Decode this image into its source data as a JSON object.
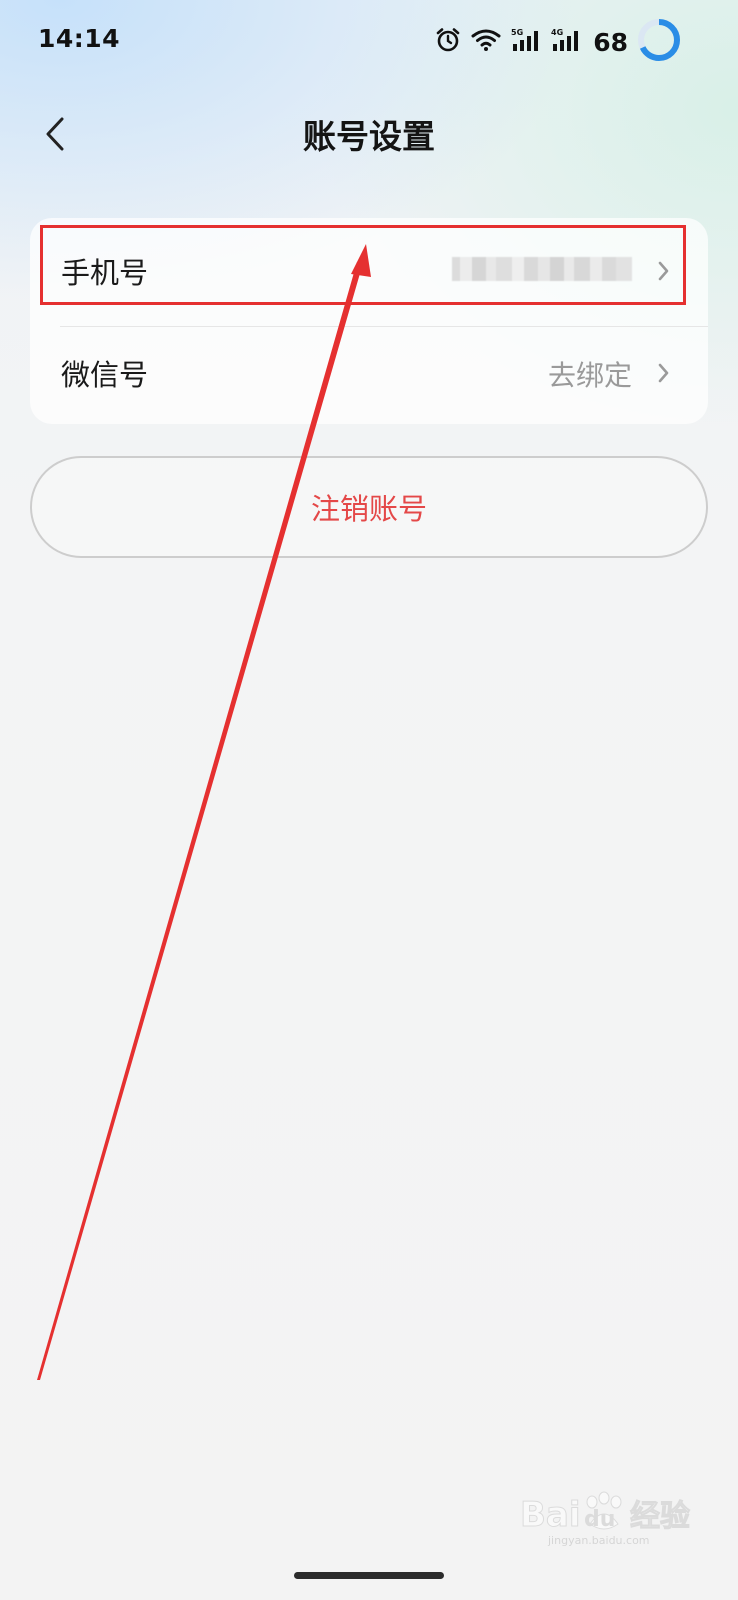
{
  "status_bar": {
    "time": "14:14",
    "battery_level": "68",
    "icons": [
      "alarm-icon",
      "wifi-icon",
      "signal-5g-icon",
      "signal-4g-icon"
    ],
    "network_5g": "5G",
    "network_4g": "4G"
  },
  "nav": {
    "title": "账号设置",
    "back_icon": "chevron-left-icon"
  },
  "settings": {
    "items": [
      {
        "label": "手机号",
        "value": "",
        "masked": true,
        "icon": "chevron-right-icon"
      },
      {
        "label": "微信号",
        "value": "去绑定",
        "icon": "chevron-right-icon"
      }
    ]
  },
  "deactivate": {
    "label": "注销账号"
  },
  "annotation": {
    "color": "#e53030"
  },
  "watermark": {
    "brand": "Baidu 经验",
    "url": "jingyan.baidu.com"
  },
  "colors": {
    "danger": "#e44848",
    "secondary_text": "#9a9a9a",
    "primary_text": "#1a1a1a"
  }
}
